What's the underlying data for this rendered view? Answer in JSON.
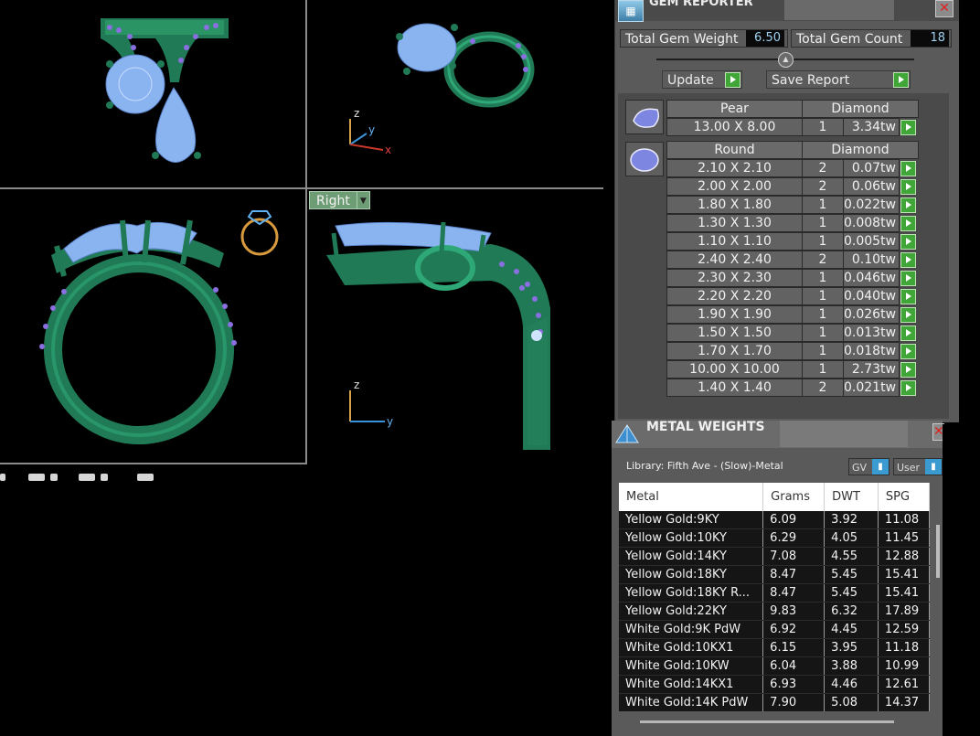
{
  "viewports": {
    "right_view_label": "Right",
    "axes": {
      "x": "x",
      "y": "y",
      "z": "z"
    }
  },
  "gem_reporter": {
    "title": "GEM REPORTER",
    "total_weight_label": "Total Gem Weight",
    "total_weight_value": "6.50",
    "total_count_label": "Total Gem Count",
    "total_count_value": "18",
    "update_label": "Update",
    "save_report_label": "Save Report",
    "groups": [
      {
        "shape": "Pear",
        "type": "Diamond",
        "rows": [
          {
            "size": "13.00 X 8.00",
            "qty": "1",
            "weight": "3.34tw"
          }
        ]
      },
      {
        "shape": "Round",
        "type": "Diamond",
        "rows": [
          {
            "size": "2.10 X 2.10",
            "qty": "2",
            "weight": "0.07tw"
          },
          {
            "size": "2.00 X 2.00",
            "qty": "2",
            "weight": "0.06tw"
          },
          {
            "size": "1.80 X 1.80",
            "qty": "1",
            "weight": "0.022tw"
          },
          {
            "size": "1.30 X 1.30",
            "qty": "1",
            "weight": "0.008tw"
          },
          {
            "size": "1.10 X 1.10",
            "qty": "1",
            "weight": "0.005tw"
          },
          {
            "size": "2.40 X 2.40",
            "qty": "2",
            "weight": "0.10tw"
          },
          {
            "size": "2.30 X 2.30",
            "qty": "1",
            "weight": "0.046tw"
          },
          {
            "size": "2.20 X 2.20",
            "qty": "1",
            "weight": "0.040tw"
          },
          {
            "size": "1.90 X 1.90",
            "qty": "1",
            "weight": "0.026tw"
          },
          {
            "size": "1.50 X 1.50",
            "qty": "1",
            "weight": "0.013tw"
          },
          {
            "size": "1.70 X 1.70",
            "qty": "1",
            "weight": "0.018tw"
          },
          {
            "size": "10.00 X 10.00",
            "qty": "1",
            "weight": "2.73tw"
          },
          {
            "size": "1.40 X 1.40",
            "qty": "2",
            "weight": "0.021tw"
          }
        ]
      }
    ]
  },
  "metal_weights": {
    "title": "METAL WEIGHTS",
    "library": "Library: Fifth Ave - (Slow)-Metal",
    "select_gv": "GV",
    "select_user": "User",
    "columns": [
      "Metal",
      "Grams",
      "DWT",
      "SPG"
    ],
    "rows": [
      [
        "Yellow Gold:9KY",
        "6.09",
        "3.92",
        "11.08"
      ],
      [
        "Yellow Gold:10KY",
        "6.29",
        "4.05",
        "11.45"
      ],
      [
        "Yellow Gold:14KY",
        "7.08",
        "4.55",
        "12.88"
      ],
      [
        "Yellow Gold:18KY",
        "8.47",
        "5.45",
        "15.41"
      ],
      [
        "Yellow Gold:18KY R...",
        "8.47",
        "5.45",
        "15.41"
      ],
      [
        "Yellow Gold:22KY",
        "9.83",
        "6.32",
        "17.89"
      ],
      [
        "White Gold:9K PdW",
        "6.92",
        "4.45",
        "12.59"
      ],
      [
        "White Gold:10KX1",
        "6.15",
        "3.95",
        "11.18"
      ],
      [
        "White Gold:10KW",
        "6.04",
        "3.88",
        "10.99"
      ],
      [
        "White Gold:14KX1",
        "6.93",
        "4.46",
        "12.61"
      ],
      [
        "White Gold:14K PdW",
        "7.90",
        "5.08",
        "14.37"
      ]
    ]
  }
}
